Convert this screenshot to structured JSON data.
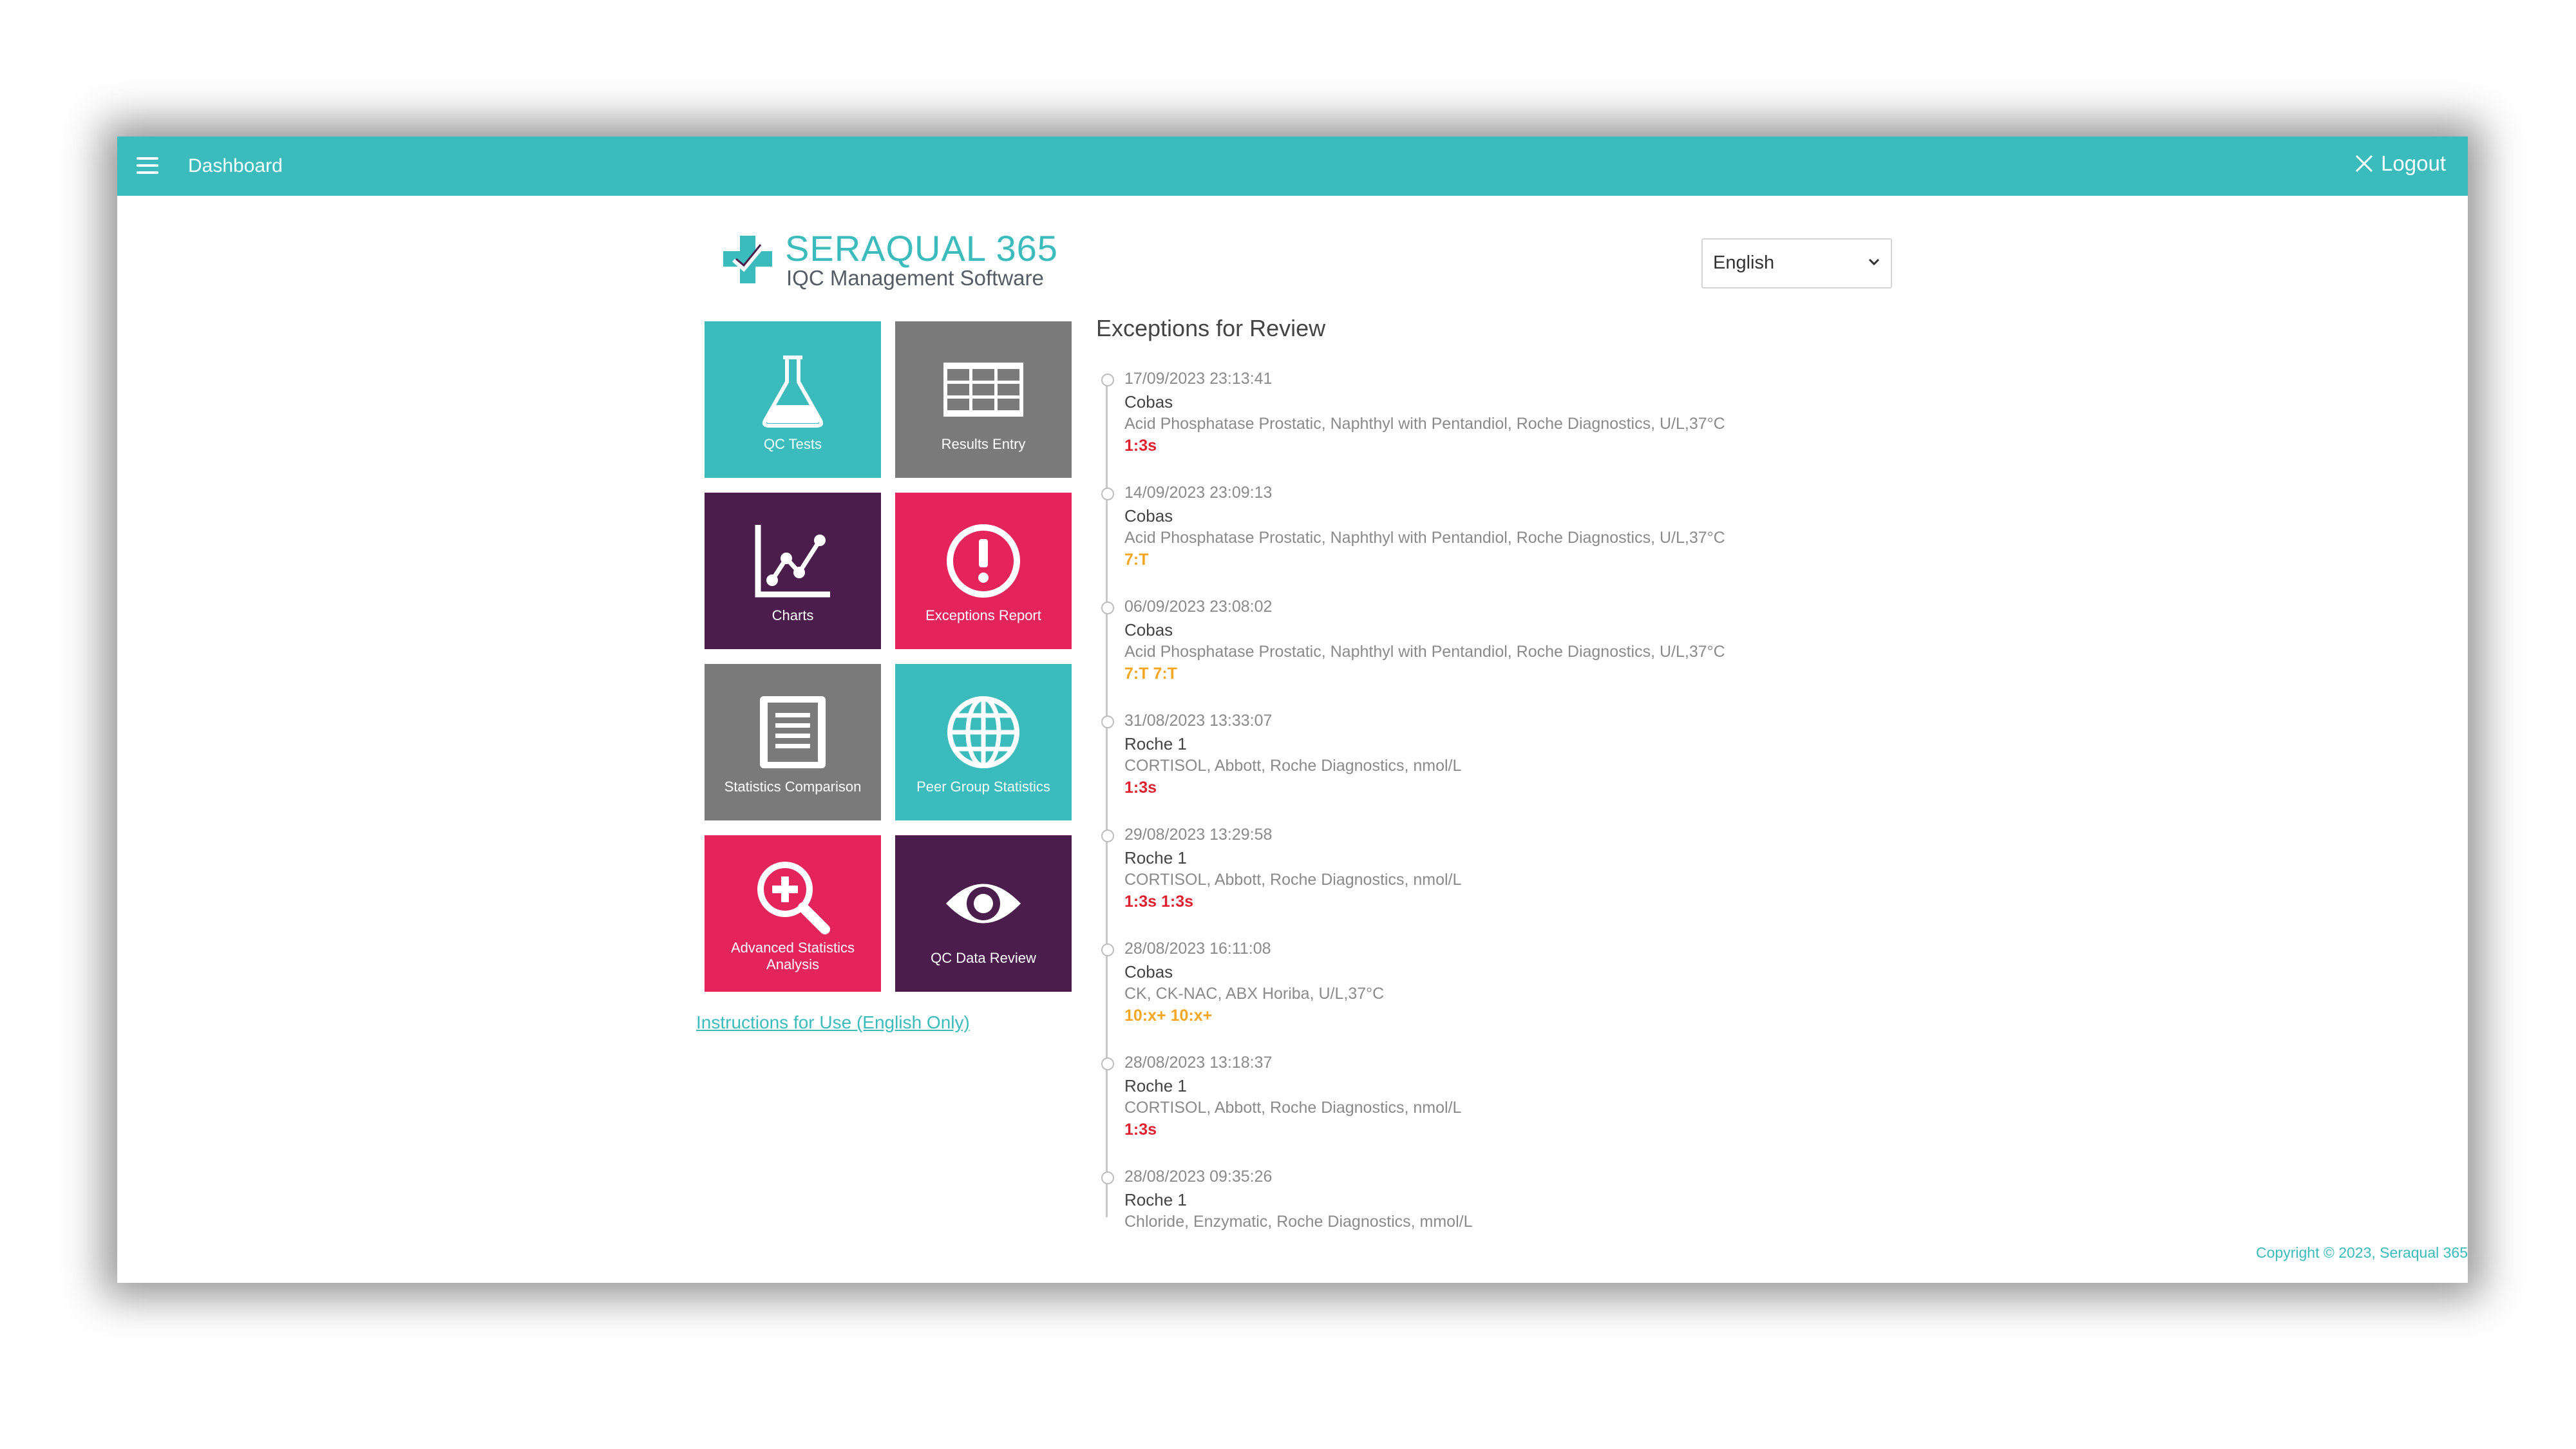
{
  "topbar": {
    "title": "Dashboard",
    "logout_label": "Logout"
  },
  "logo": {
    "name": "SERAQUAL 365",
    "subtitle": "IQC Management Software"
  },
  "language": {
    "selected": "English"
  },
  "tiles": [
    {
      "label": "QC Tests",
      "icon": "flask-icon",
      "color": "#3bbbbb"
    },
    {
      "label": "Results Entry",
      "icon": "table-grid-icon",
      "color": "#7a7a7a"
    },
    {
      "label": "Charts",
      "icon": "line-chart-icon",
      "color": "#4a1d4d"
    },
    {
      "label": "Exceptions Report",
      "icon": "exclamation-circle-icon",
      "color": "#e6245c"
    },
    {
      "label": "Statistics Comparison",
      "icon": "document-icon",
      "color": "#7a7a7a"
    },
    {
      "label": "Peer Group Statistics",
      "icon": "globe-icon",
      "color": "#3bbbbb"
    },
    {
      "label": "Advanced Statistics Analysis",
      "icon": "magnifier-plus-icon",
      "color": "#e6245c"
    },
    {
      "label": "QC Data Review",
      "icon": "eye-icon",
      "color": "#4a1d4d"
    }
  ],
  "instructions_link": "Instructions for Use (English Only)",
  "exceptions": {
    "title": "Exceptions for Review",
    "items": [
      {
        "datetime": "17/09/2023 23:13:41",
        "instrument": "Cobas",
        "test": "Acid Phosphatase Prostatic, Naphthyl with Pentandiol, Roche Diagnostics, U/L,37°C",
        "rule": "1:3s",
        "rule_color": "#e0202f"
      },
      {
        "datetime": "14/09/2023 23:09:13",
        "instrument": "Cobas",
        "test": "Acid Phosphatase Prostatic, Naphthyl with Pentandiol, Roche Diagnostics, U/L,37°C",
        "rule": "7:T",
        "rule_color": "#f5a623"
      },
      {
        "datetime": "06/09/2023 23:08:02",
        "instrument": "Cobas",
        "test": "Acid Phosphatase Prostatic, Naphthyl with Pentandiol, Roche Diagnostics, U/L,37°C",
        "rule": "7:T 7:T",
        "rule_color": "#f5a623"
      },
      {
        "datetime": "31/08/2023 13:33:07",
        "instrument": "Roche 1",
        "test": "CORTISOL, Abbott, Roche Diagnostics, nmol/L",
        "rule": "1:3s",
        "rule_color": "#e0202f"
      },
      {
        "datetime": "29/08/2023 13:29:58",
        "instrument": "Roche 1",
        "test": "CORTISOL, Abbott, Roche Diagnostics, nmol/L",
        "rule": "1:3s 1:3s",
        "rule_color": "#e0202f"
      },
      {
        "datetime": "28/08/2023 16:11:08",
        "instrument": "Cobas",
        "test": "CK, CK-NAC, ABX Horiba, U/L,37°C",
        "rule": "10:x+ 10:x+",
        "rule_color": "#f5a623"
      },
      {
        "datetime": "28/08/2023 13:18:37",
        "instrument": "Roche 1",
        "test": "CORTISOL, Abbott, Roche Diagnostics, nmol/L",
        "rule": "1:3s",
        "rule_color": "#e0202f"
      },
      {
        "datetime": "28/08/2023 09:35:26",
        "instrument": "Roche 1",
        "test": "Chloride, Enzymatic, Roche Diagnostics, mmol/L",
        "rule": "",
        "rule_color": "#e0202f"
      }
    ]
  },
  "copyright": "Copyright © 2023, Seraqual 365"
}
